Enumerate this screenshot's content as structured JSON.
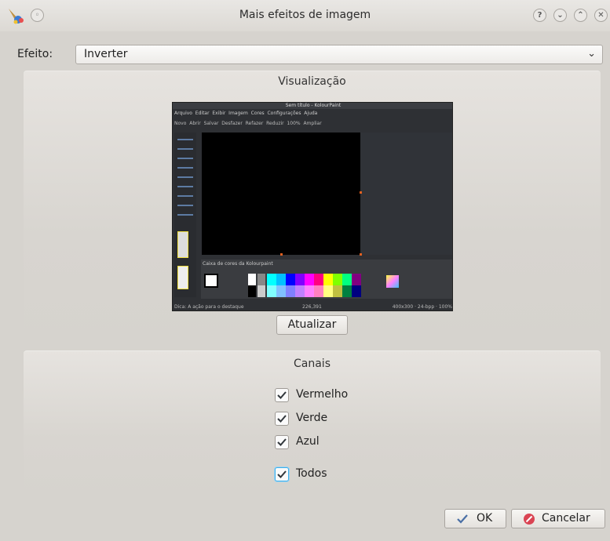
{
  "window": {
    "title": "Mais efeitos de imagem",
    "menu_glyph": "◦",
    "buttons": {
      "help": "?",
      "minimize": "⌄",
      "maximize": "⌃",
      "close": "✕"
    }
  },
  "effect": {
    "label": "Efeito:",
    "value": "Inverter",
    "arrow": "⌄"
  },
  "preview_group": {
    "title": "Visualização",
    "update_button": "Atualizar",
    "screenshot": {
      "title": "Sem título - KolourPaint",
      "menu": [
        "Arquivo",
        "Editar",
        "Exibir",
        "Imagem",
        "Cores",
        "Configurações",
        "Ajuda"
      ],
      "toolbar": [
        "Novo",
        "Abrir",
        "Salvar",
        "Desfazer",
        "Refazer",
        "Reduzir",
        "100%",
        "Ampliar"
      ],
      "colors_box_label": "Caixa de cores da Kolourpaint",
      "status_left": "Dica: A ação para o destaque",
      "status_mid": "226,391",
      "status_right": "400x300 · 24-bpp · 100%"
    }
  },
  "channels_group": {
    "title": "Canais",
    "channels": [
      {
        "label": "Vermelho",
        "checked": true
      },
      {
        "label": "Verde",
        "checked": true
      },
      {
        "label": "Azul",
        "checked": true
      }
    ],
    "all": {
      "label": "Todos",
      "checked": true
    }
  },
  "footer": {
    "ok": "OK",
    "cancel": "Cancelar"
  },
  "colors": {
    "accent": "#3daee9",
    "palette": [
      "#000000",
      "#808080",
      "#800000",
      "#808000",
      "#008000",
      "#008080",
      "#000080",
      "#800080",
      "#ffffff",
      "#c0c0c0",
      "#ff0000",
      "#ffff00",
      "#00ff00",
      "#00ffff",
      "#0000ff",
      "#ff00ff"
    ]
  }
}
